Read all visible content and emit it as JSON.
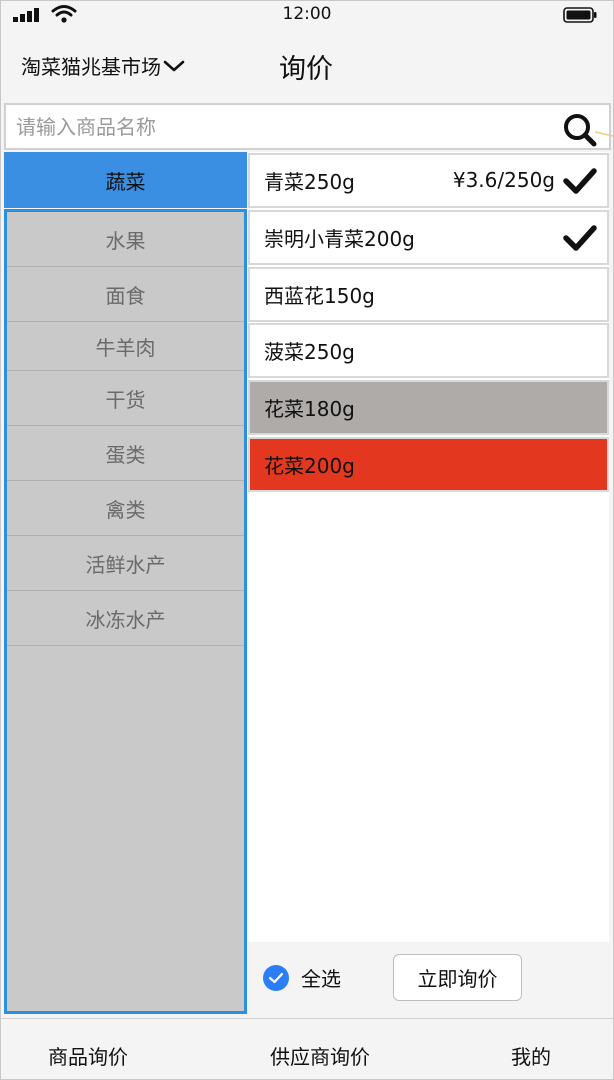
{
  "status_bar": {
    "time": "12:00"
  },
  "header": {
    "market_name": "淘菜猫兆基市场",
    "title": "询价"
  },
  "search": {
    "placeholder": "请输入商品名称"
  },
  "sidebar": {
    "active": "蔬菜",
    "items": [
      "水果",
      "面食",
      "牛羊肉",
      "干货",
      "蛋类",
      "禽类",
      "活鲜水产",
      "冰冻水产"
    ]
  },
  "products": [
    {
      "name": "青菜250g",
      "price": "¥3.6/250g",
      "checked": true,
      "bg": "#ffffff"
    },
    {
      "name": "崇明小青菜200g",
      "price": "",
      "checked": true,
      "bg": "#ffffff"
    },
    {
      "name": "西蓝花150g",
      "price": "",
      "checked": false,
      "bg": "#ffffff"
    },
    {
      "name": "菠菜250g",
      "price": "",
      "checked": false,
      "bg": "#ffffff"
    },
    {
      "name": "花菜180g",
      "price": "",
      "checked": false,
      "bg": "#aeaba9"
    },
    {
      "name": "花菜200g",
      "price": "",
      "checked": false,
      "bg": "#e3371f"
    }
  ],
  "actions": {
    "select_all": "全选",
    "inquiry_now": "立即询价"
  },
  "tabbar": {
    "tab1": "商品询价",
    "tab2": "供应商询价",
    "tab3": "我的"
  },
  "colors": {
    "accent_blue": "#3a8fe3",
    "sidebar_border": "#2d8fe0",
    "highlight_red": "#e3371f",
    "highlight_grey": "#aeaba9"
  }
}
